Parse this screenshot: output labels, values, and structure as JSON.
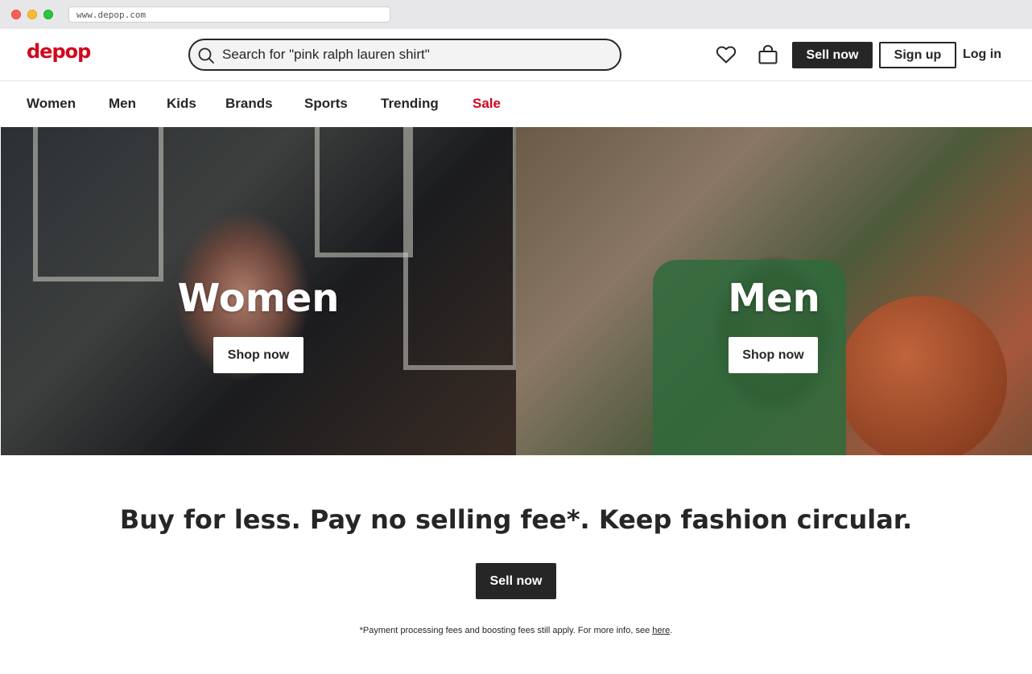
{
  "browser": {
    "url": "www.depop.com"
  },
  "header": {
    "logo": "depop",
    "search_placeholder": "Search for \"pink ralph lauren shirt\"",
    "sell_now": "Sell now",
    "sign_up": "Sign up",
    "log_in": "Log in",
    "icons": [
      "search-icon",
      "heart-icon",
      "bag-icon"
    ]
  },
  "nav": {
    "items": [
      "Women",
      "Men",
      "Kids",
      "Brands",
      "Sports",
      "Trending",
      "Sale"
    ]
  },
  "hero": {
    "women": {
      "title": "Women",
      "button": "Shop now"
    },
    "men": {
      "title": "Men",
      "button": "Shop now"
    }
  },
  "promo": {
    "tagline": "Buy for less. Pay no selling fee*. Keep fashion circular.",
    "button": "Sell now",
    "footnote": "*Payment processing fees and boosting fees still apply. For more info, see",
    "footnote_link": "here",
    "footnote_end": "."
  },
  "colors": {
    "brand": "#d1071e",
    "dark": "#262626"
  }
}
